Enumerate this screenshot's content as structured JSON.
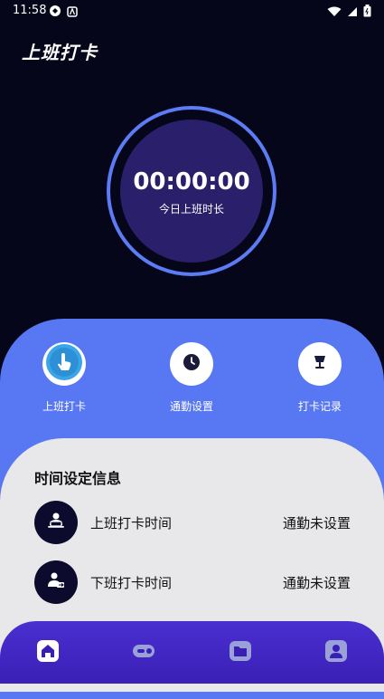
{
  "status_bar": {
    "time": "11:58"
  },
  "header": {
    "title": "上班打卡"
  },
  "timer": {
    "value": "00:00:00",
    "label": "今日上班时长"
  },
  "actions": [
    {
      "label": "上班打卡",
      "icon": "tap-hand-icon"
    },
    {
      "label": "通勤设置",
      "icon": "clock-icon"
    },
    {
      "label": "打卡记录",
      "icon": "lamp-icon"
    }
  ],
  "settings": {
    "title": "时间设定信息",
    "rows": [
      {
        "label": "上班打卡时间",
        "value": "通勤未设置",
        "icon": "laptop-user-icon"
      },
      {
        "label": "下班打卡时间",
        "value": "通勤未设置",
        "icon": "user-exit-icon"
      }
    ]
  },
  "tabbar": {
    "items": [
      "home-icon",
      "toggle-icon",
      "folder-icon",
      "profile-icon"
    ]
  },
  "colors": {
    "background": "#06061a",
    "accent_blue": "#5877f2",
    "timer_ring": "#5b7cf5",
    "timer_fill": "#2a1f6a",
    "tabbar": "#3a1fb5"
  }
}
